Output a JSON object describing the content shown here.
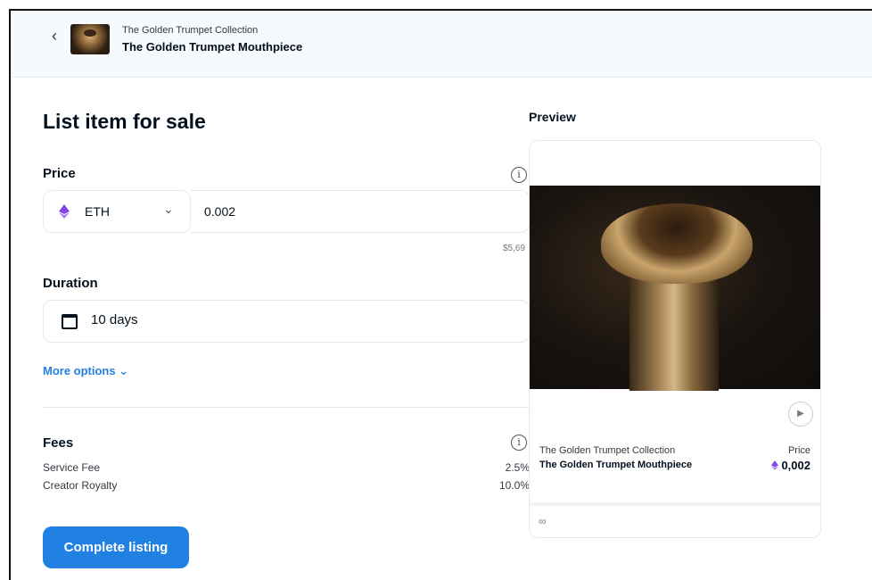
{
  "header": {
    "collection": "The Golden Trumpet Collection",
    "item_name": "The Golden Trumpet Mouthpiece",
    "back_icon": "chevron-left-icon"
  },
  "form": {
    "title": "List item for sale",
    "price": {
      "label": "Price",
      "currency": "ETH",
      "amount": "0.002",
      "usd_value": "$5,69"
    },
    "duration": {
      "label": "Duration",
      "value": "10 days"
    },
    "more_options": "More options",
    "fees": {
      "label": "Fees",
      "items": [
        {
          "name": "Service Fee",
          "value": "2.5%"
        },
        {
          "name": "Creator Royalty",
          "value": "10.0%"
        }
      ]
    },
    "submit": "Complete listing"
  },
  "preview": {
    "label": "Preview",
    "collection": "The Golden Trumpet Collection",
    "name": "The Golden Trumpet Mouthpiece",
    "price_label": "Price",
    "price": "0,002"
  },
  "colors": {
    "accent": "#2081e2",
    "eth": "#8247e5",
    "text": "#04111d"
  }
}
